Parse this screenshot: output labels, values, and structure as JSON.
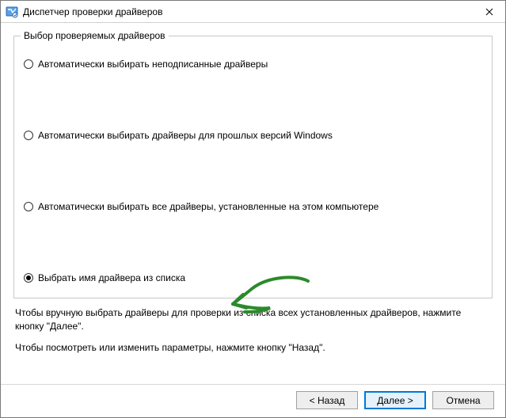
{
  "titlebar": {
    "title": "Диспетчер проверки драйверов"
  },
  "group": {
    "legend": "Выбор проверяемых драйверов",
    "options": {
      "unsigned": "Автоматически выбирать неподписанные драйверы",
      "older": "Автоматически выбирать драйверы для прошлых версий Windows",
      "all": "Автоматически выбирать все драйверы, установленные на этом компьютере",
      "list": "Выбрать имя драйвера из списка"
    }
  },
  "info": {
    "para1": "Чтобы вручную выбрать драйверы для проверки из списка всех установленных драйверов, нажмите кнопку \"Далее\".",
    "para2": "Чтобы посмотреть или изменить параметры, нажмите кнопку \"Назад\"."
  },
  "footer": {
    "back": "< Назад",
    "next": "Далее >",
    "cancel": "Отмена"
  }
}
